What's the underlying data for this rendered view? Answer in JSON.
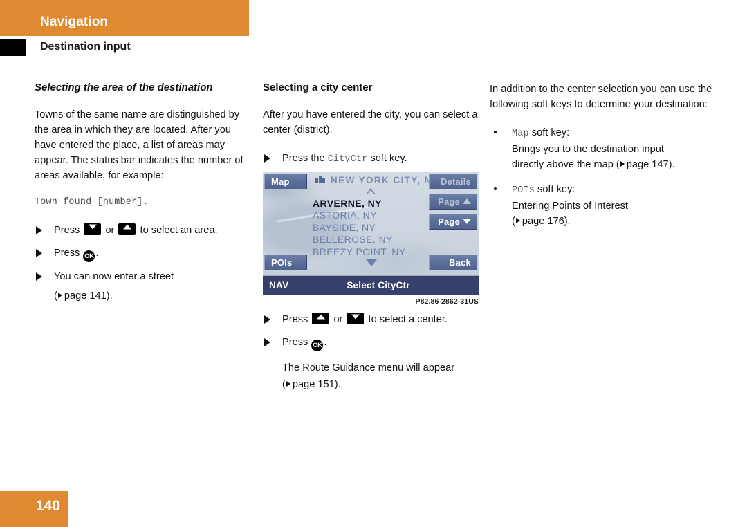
{
  "header": {
    "chapter": "Navigation",
    "section": "Destination input",
    "accent_color": "#df8a31",
    "marker_color": "#000000"
  },
  "columns": {
    "left": {
      "heading": "Selecting the area of the destination",
      "paragraph": "Towns of the same name are distinguished by the area in which they are located. After you have entered the place, a list of areas may appear. The status bar indicates the number of areas available, for example:",
      "code_example": "Town found [number].",
      "steps": [
        {
          "prefix": "Press",
          "key_a": "down-arrow-key",
          "conj": "or",
          "key_b": "up-arrow-key",
          "suffix": "to select an area."
        },
        {
          "prefix": "Press",
          "key": "ok-key",
          "suffix": "."
        },
        {
          "text": "You can now enter a street",
          "ref": "page 141"
        }
      ]
    },
    "middle": {
      "heading": "Selecting a city center",
      "paragraph": "After you have entered the city, you can select a center (district).",
      "step_soft_key": {
        "prefix": "Press the",
        "code": "CityCtr",
        "suffix": "soft key."
      },
      "figure_caption": "P82.86-2862-31US",
      "steps_after": [
        {
          "prefix": "Press",
          "key_a": "up-arrow-key",
          "conj": "or",
          "key_b": "down-arrow-key",
          "suffix": "to select a center."
        },
        {
          "prefix": "Press",
          "key": "ok-key",
          "suffix": "."
        }
      ],
      "result_text": "The Route Guidance menu will appear",
      "result_ref": "page 151"
    },
    "right": {
      "paragraph": "In addition to the center selection you can use the following soft keys to determine your destination:",
      "bullets": [
        {
          "code": "Map",
          "label": "soft key:",
          "lines": [
            "Brings you to the destination input",
            "directly above the map ("
          ],
          "ref": "page 147",
          "tail": ")."
        },
        {
          "code": "POIs",
          "label": "soft key:",
          "lines": [
            "Entering Points of Interest",
            "("
          ],
          "ref": "page 176",
          "tail": ")."
        }
      ]
    }
  },
  "nav_screen": {
    "soft_keys": {
      "map": "Map",
      "pois": "POIs",
      "details": "Details",
      "page_up": "Page",
      "page_down": "Page",
      "back": "Back"
    },
    "city_header": "NEW YORK CITY, NY",
    "list": [
      {
        "label": "ARVERNE, NY",
        "selected": true
      },
      {
        "label": "ASTORIA, NY",
        "selected": false
      },
      {
        "label": "BAYSIDE, NY",
        "selected": false
      },
      {
        "label": "BELLEROSE, NY",
        "selected": false
      },
      {
        "label": "BREEZY POINT, NY",
        "selected": false
      }
    ],
    "status_mode": "NAV",
    "status_title": "Select CityCtr",
    "colors": {
      "soft_key": "#5a6e99",
      "status_bar": "#37406b",
      "map_bg": "#ccd5e0",
      "list_text": "#6c80a9",
      "selected_text": "#10141c"
    }
  },
  "footer": {
    "page_number": "140"
  }
}
